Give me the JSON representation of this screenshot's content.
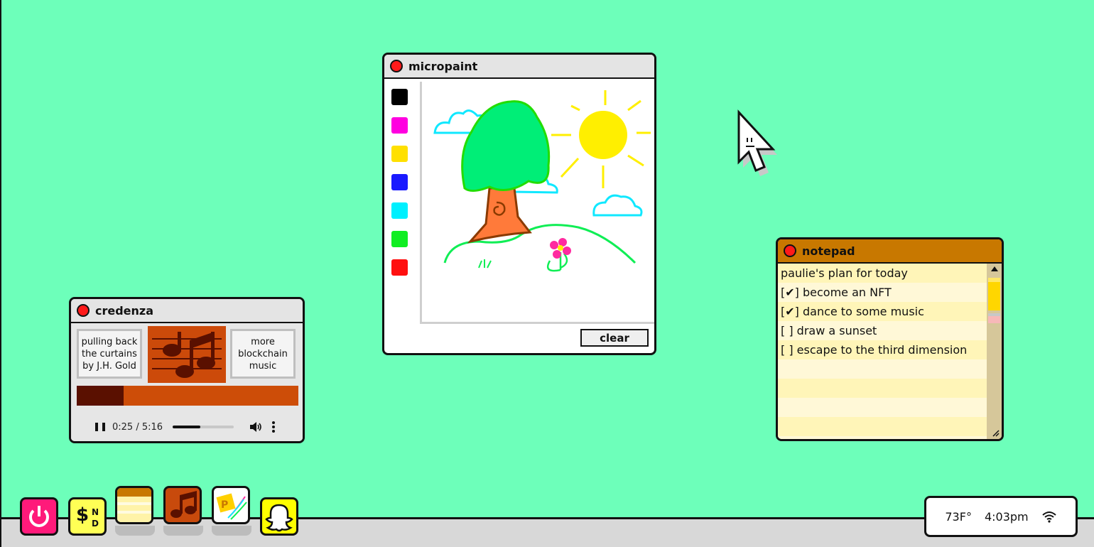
{
  "desktop": {
    "background": "#6dffba"
  },
  "micropaint": {
    "title": "micropaint",
    "palette": [
      {
        "name": "black",
        "color": "#000000"
      },
      {
        "name": "magenta",
        "color": "#ff00e0"
      },
      {
        "name": "yellow",
        "color": "#ffe000"
      },
      {
        "name": "blue",
        "color": "#1a1aff"
      },
      {
        "name": "cyan",
        "color": "#00f0ff"
      },
      {
        "name": "green",
        "color": "#10ee22"
      },
      {
        "name": "red",
        "color": "#ff1010"
      }
    ],
    "clear_label": "clear"
  },
  "credenza": {
    "title": "credenza",
    "track": "pulling back the curtains by J.H. Gold",
    "next_link": "more blockchain music",
    "progress": 0.21,
    "time": "0:25 / 5:16",
    "seek_fraction": 0.45
  },
  "notepad": {
    "title": "notepad",
    "lines": [
      "paulie's plan for today",
      "[✔] become an NFT",
      "[✔] dance to some music",
      "[ ] draw a sunset",
      "[ ] escape to the third dimension",
      "",
      "",
      "",
      ""
    ]
  },
  "dock": [
    {
      "name": "power",
      "color": "#ff1a7a"
    },
    {
      "name": "ens",
      "color": "#ffff55"
    },
    {
      "name": "notepad",
      "color": "#fff3a8"
    },
    {
      "name": "credenza",
      "color": "#c84a0c"
    },
    {
      "name": "micropaint",
      "color": "#ffffff"
    },
    {
      "name": "snapchat",
      "color": "#ffff00"
    }
  ],
  "tray": {
    "temperature": "73F°",
    "time": "4:03pm",
    "wifi_icon": "wifi-icon"
  }
}
